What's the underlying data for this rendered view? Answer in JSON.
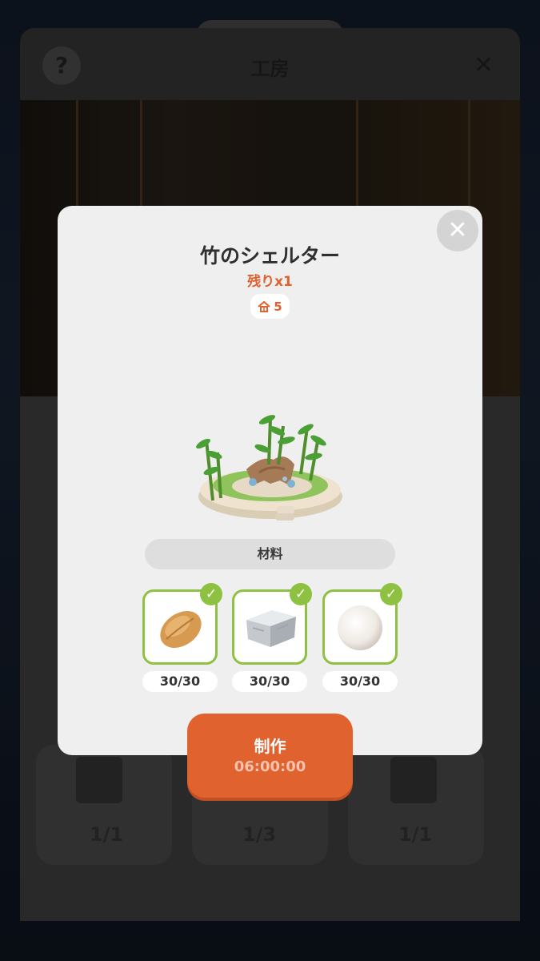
{
  "background": {
    "title": "工房",
    "help_icon": "?",
    "close_icon": "✕",
    "card_counts": [
      "1/1",
      "1/3",
      "1/1"
    ]
  },
  "modal": {
    "title": "竹のシェルター",
    "remaining": "残りx1",
    "comfort_value": "5",
    "close_icon": "✕",
    "materials_label": "材料",
    "materials": [
      {
        "icon": "almond-icon",
        "count": "30/30",
        "complete": true
      },
      {
        "icon": "stone-block-icon",
        "count": "30/30",
        "complete": true
      },
      {
        "icon": "pearl-icon",
        "count": "30/30",
        "complete": true
      }
    ],
    "craft": {
      "label": "制作",
      "time": "06:00:00"
    }
  },
  "colors": {
    "accent": "#e0622f",
    "check": "#8ec041",
    "modal_bg": "#efefef"
  }
}
